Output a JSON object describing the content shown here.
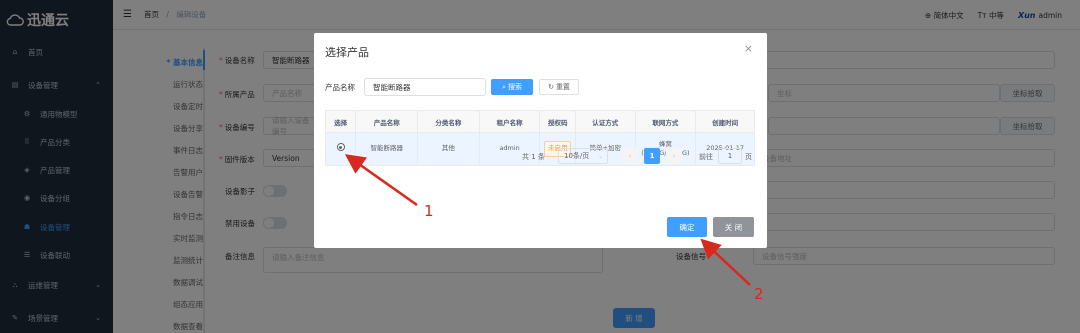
{
  "app": {
    "logo_text": "迅通云"
  },
  "sidebar": {
    "items": [
      {
        "label": "首页",
        "icon": "home-icon",
        "chevron": ""
      },
      {
        "label": "设备管理",
        "icon": "device-icon",
        "chevron": "⌃"
      },
      {
        "label": "通用物模型",
        "icon": "model-icon",
        "chevron": ""
      },
      {
        "label": "产品分类",
        "icon": "category-icon",
        "chevron": ""
      },
      {
        "label": "产品管理",
        "icon": "product-icon",
        "chevron": ""
      },
      {
        "label": "设备分组",
        "icon": "group-icon",
        "chevron": ""
      },
      {
        "label": "设备管理",
        "icon": "device-manage-icon",
        "chevron": ""
      },
      {
        "label": "设备联动",
        "icon": "linkage-icon",
        "chevron": ""
      },
      {
        "label": "运维管理",
        "icon": "ops-icon",
        "chevron": "⌄"
      },
      {
        "label": "场景管理",
        "icon": "scene-icon",
        "chevron": "⌄"
      }
    ]
  },
  "header": {
    "breadcrumb": [
      "首页",
      "编辑设备"
    ],
    "separator": "/",
    "language": "简体中文",
    "font_size": "中等",
    "user": "admin",
    "avatar_text": "Xun"
  },
  "page": {
    "left_nav": [
      "* 基本信息",
      "运行状态",
      "设备定时",
      "设备分享",
      "事件日志",
      "告警用户",
      "设备告警",
      "指令日志",
      "实时监测",
      "监测统计",
      "数据调试",
      "组态应用",
      "数据查看"
    ],
    "form": {
      "device_name_label": "设备名称",
      "device_name_value": "智能断路器",
      "product_label": "所属产品",
      "product_placeholder": "产品名称",
      "device_no_label": "设备编号",
      "device_no_placeholder": "请输入设备编号",
      "firmware_label": "固件版本",
      "firmware_value": "Version",
      "shadow_label": "设备影子",
      "disable_label": "禁用设备",
      "remark_label": "备注信息",
      "remark_placeholder": "请输入备注信息",
      "signal_label": "设备信号",
      "signal_placeholder": "设备信号强度",
      "right_placeholder_1": "坐标",
      "right_placeholder_2": "设备地址",
      "side_btn_1": "坐标拾取",
      "side_btn_2": "坐标拾取",
      "add_button": "新 增"
    }
  },
  "dialog": {
    "title": "选择产品",
    "close": "×",
    "search_label": "产品名称",
    "search_value": "智能断路器",
    "search_button": "搜索",
    "reset_button": "重置",
    "columns": [
      "选择",
      "产品名称",
      "分类名称",
      "租户名称",
      "授权码",
      "认证方式",
      "联网方式",
      "创建时间"
    ],
    "rows": [
      {
        "product_name": "智能断路器",
        "category": "其他",
        "tenant": "admin",
        "auth_code": "未启用",
        "auth_method": "简单+加密",
        "network": "蜂窝(2G/3G/4G/5G)",
        "created": "2025-01-17",
        "selected": true
      }
    ],
    "pagination": {
      "total": "共 1 条",
      "page_size": "10条/页",
      "current_page": "1",
      "goto_label": "前往",
      "goto_value": "1",
      "page_unit": "页"
    },
    "ok_button": "确定",
    "cancel_button": "关 闭"
  },
  "annotations": [
    {
      "label": "1"
    },
    {
      "label": "2"
    }
  ],
  "colors": {
    "primary": "#409eff",
    "sidebar_bg": "#1f2d3d",
    "annotation": "#d9281e"
  }
}
